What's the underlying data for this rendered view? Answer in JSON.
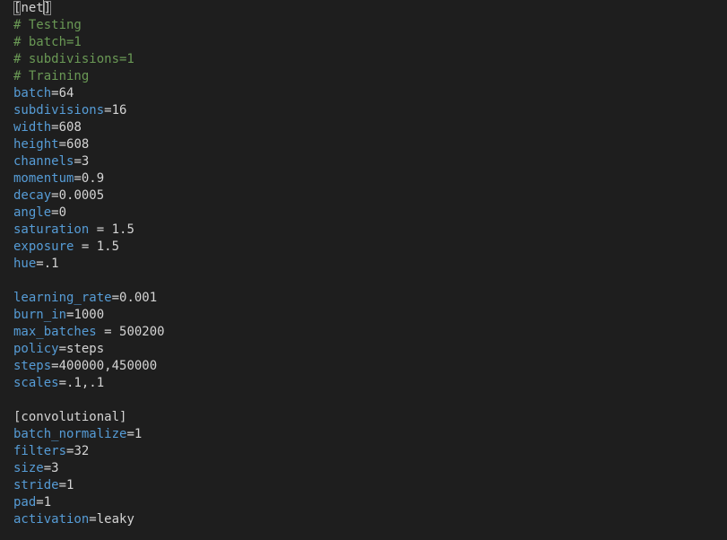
{
  "colors": {
    "background": "#1e1e1e",
    "key": "#569cd6",
    "text": "#d4d4d4",
    "comment": "#6a9955"
  },
  "lines": [
    {
      "type": "section-bracketed",
      "open": "[",
      "name": "net",
      "close": "]"
    },
    {
      "type": "comment",
      "text": "# Testing"
    },
    {
      "type": "comment",
      "text": "# batch=1"
    },
    {
      "type": "comment",
      "text": "# subdivisions=1"
    },
    {
      "type": "comment",
      "text": "# Training"
    },
    {
      "type": "kv",
      "key": "batch",
      "sep": "=",
      "value": "64"
    },
    {
      "type": "kv",
      "key": "subdivisions",
      "sep": "=",
      "value": "16"
    },
    {
      "type": "kv",
      "key": "width",
      "sep": "=",
      "value": "608"
    },
    {
      "type": "kv",
      "key": "height",
      "sep": "=",
      "value": "608"
    },
    {
      "type": "kv",
      "key": "channels",
      "sep": "=",
      "value": "3"
    },
    {
      "type": "kv",
      "key": "momentum",
      "sep": "=",
      "value": "0.9"
    },
    {
      "type": "kv",
      "key": "decay",
      "sep": "=",
      "value": "0.0005"
    },
    {
      "type": "kv",
      "key": "angle",
      "sep": "=",
      "value": "0"
    },
    {
      "type": "kv",
      "key": "saturation",
      "sep": " = ",
      "value": "1.5"
    },
    {
      "type": "kv",
      "key": "exposure",
      "sep": " = ",
      "value": "1.5"
    },
    {
      "type": "kv",
      "key": "hue",
      "sep": "=",
      "value": ".1"
    },
    {
      "type": "blank"
    },
    {
      "type": "kv",
      "key": "learning_rate",
      "sep": "=",
      "value": "0.001"
    },
    {
      "type": "kv",
      "key": "burn_in",
      "sep": "=",
      "value": "1000"
    },
    {
      "type": "kv",
      "key": "max_batches",
      "sep": " = ",
      "value": "500200"
    },
    {
      "type": "kv",
      "key": "policy",
      "sep": "=",
      "value": "steps"
    },
    {
      "type": "kv",
      "key": "steps",
      "sep": "=",
      "value": "400000,450000"
    },
    {
      "type": "kv",
      "key": "scales",
      "sep": "=",
      "value": ".1,.1"
    },
    {
      "type": "blank"
    },
    {
      "type": "section",
      "text": "[convolutional]"
    },
    {
      "type": "kv",
      "key": "batch_normalize",
      "sep": "=",
      "value": "1"
    },
    {
      "type": "kv",
      "key": "filters",
      "sep": "=",
      "value": "32"
    },
    {
      "type": "kv",
      "key": "size",
      "sep": "=",
      "value": "3"
    },
    {
      "type": "kv",
      "key": "stride",
      "sep": "=",
      "value": "1"
    },
    {
      "type": "kv",
      "key": "pad",
      "sep": "=",
      "value": "1"
    },
    {
      "type": "kv",
      "key": "activation",
      "sep": "=",
      "value": "leaky"
    }
  ]
}
